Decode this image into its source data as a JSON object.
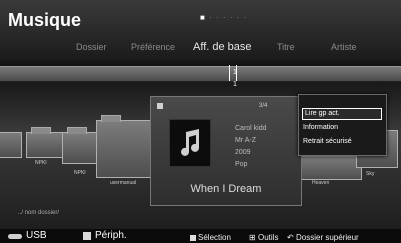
{
  "app": {
    "title": "Musique"
  },
  "tabs": [
    {
      "label": "Dossier"
    },
    {
      "label": "Préférence"
    },
    {
      "label": "Aff. de base"
    },
    {
      "label": "Titre"
    },
    {
      "label": "Artiste"
    }
  ],
  "timeline": {
    "top_number": "1",
    "bottom_number": "1"
  },
  "folders": [
    {
      "label": "NPKI"
    },
    {
      "label": "NPKI"
    },
    {
      "label": "usermanual"
    },
    {
      "label": "Heaven"
    },
    {
      "label": "Sky"
    }
  ],
  "current_item": {
    "count": "3/4",
    "artist": "Carol kidd",
    "album": "Mr A-Z",
    "year": "2009",
    "genre": "Pop",
    "song_title": "When I Dream",
    "thumb_icon": "music-note-icon"
  },
  "context_menu": {
    "items": [
      {
        "label": "Lire gp act.",
        "selected": true
      },
      {
        "label": "Information",
        "selected": false
      },
      {
        "label": "Retrait sécurisé",
        "selected": false
      }
    ]
  },
  "path": "../ nom dossier/",
  "footer": {
    "usb_label": "USB",
    "periph_label": "Périph.",
    "selection_label": "Sélection",
    "tools_label": "Outils",
    "return_label": "Dossier supérieur"
  }
}
